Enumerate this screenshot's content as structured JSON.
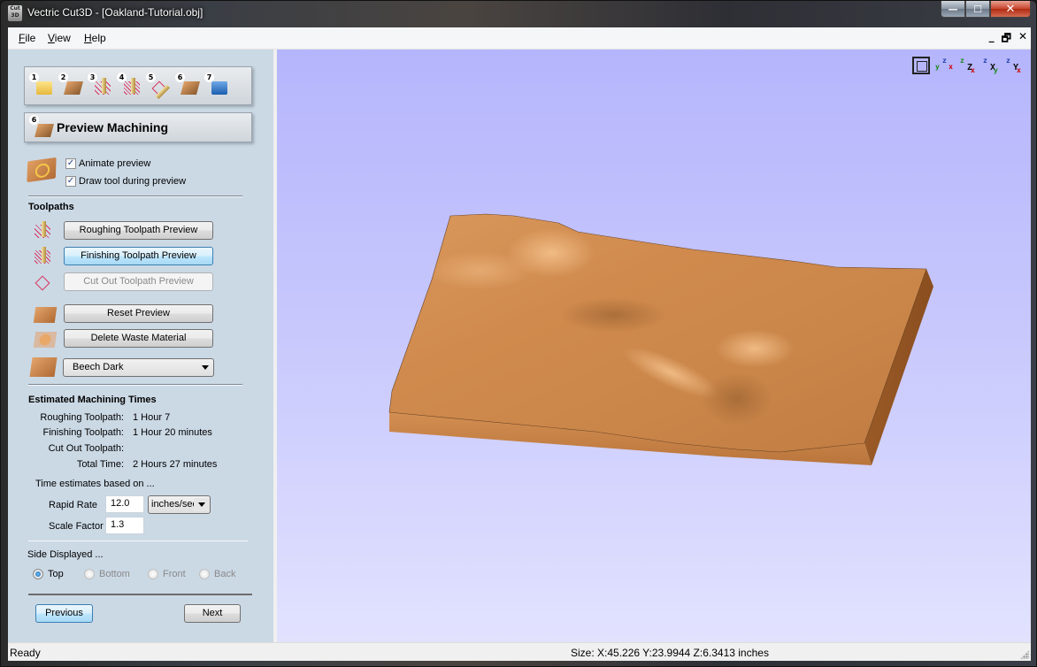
{
  "window": {
    "title": "Vectric Cut3D - [Oakland-Tutorial.obj]",
    "app_icon_label": "Cut 3D",
    "minimize": "—",
    "maximize": "☐",
    "close": "✕"
  },
  "menubar": {
    "items": [
      {
        "label": "File",
        "accel": "F",
        "rest": "ile"
      },
      {
        "label": "View",
        "accel": "V",
        "rest": "iew"
      },
      {
        "label": "Help",
        "accel": "H",
        "rest": "elp"
      }
    ],
    "mdi_minimize": "_",
    "mdi_restore": "🗗",
    "mdi_close": "✕"
  },
  "wizard": {
    "steps": [
      {
        "num": "1",
        "icon": "open-folder-icon"
      },
      {
        "num": "2",
        "icon": "material-block-icon"
      },
      {
        "num": "3",
        "icon": "roughing-toolpath-icon"
      },
      {
        "num": "4",
        "icon": "finishing-toolpath-icon"
      },
      {
        "num": "5",
        "icon": "cutout-toolpath-icon"
      },
      {
        "num": "6",
        "icon": "preview-machining-icon"
      },
      {
        "num": "7",
        "icon": "save-toolpaths-icon"
      }
    ],
    "current_step_num": "6",
    "current_step_title": "Preview Machining"
  },
  "preview_options": {
    "animate_label": "Animate preview",
    "animate_checked": true,
    "draw_tool_label": "Draw tool during preview",
    "draw_tool_checked": true,
    "check_mark": "✓"
  },
  "toolpaths": {
    "title": "Toolpaths",
    "roughing_button": "Roughing Toolpath Preview",
    "finishing_button": "Finishing Toolpath Preview",
    "cutout_button": "Cut Out Toolpath Preview",
    "reset_button": "Reset Preview",
    "delete_waste_button": "Delete Waste Material",
    "material_selected": "Beech Dark"
  },
  "times": {
    "title": "Estimated Machining Times",
    "rows": [
      {
        "label": "Roughing Toolpath:",
        "value": "1 Hour 7"
      },
      {
        "label": "Finishing Toolpath:",
        "value": "1 Hour 20 minutes"
      },
      {
        "label": "Cut Out Toolpath:",
        "value": ""
      },
      {
        "label": "Total Time:",
        "value": "2 Hours 27 minutes"
      }
    ],
    "based_on": "Time estimates based on ...",
    "rapid_rate_label": "Rapid Rate",
    "rapid_rate_value": "12.0",
    "rapid_rate_unit": "inches/sec",
    "scale_factor_label": "Scale Factor",
    "scale_factor_value": "1.3"
  },
  "side_displayed": {
    "title": "Side Displayed ...",
    "options": [
      {
        "label": "Top",
        "selected": true,
        "enabled": true
      },
      {
        "label": "Bottom",
        "selected": false,
        "enabled": false
      },
      {
        "label": "Front",
        "selected": false,
        "enabled": false
      },
      {
        "label": "Back",
        "selected": false,
        "enabled": false
      }
    ]
  },
  "nav": {
    "previous": "Previous",
    "next": "Next"
  },
  "view_toolbar": [
    {
      "name": "zoom-extents-icon"
    },
    {
      "name": "iso-view-icon",
      "labels": [
        "y",
        "z",
        "x"
      ]
    },
    {
      "name": "view-along-z-icon",
      "labels": [
        "z",
        "Z",
        "x"
      ]
    },
    {
      "name": "view-along-x-icon",
      "labels": [
        "z",
        "X",
        "y"
      ]
    },
    {
      "name": "view-along-y-icon",
      "labels": [
        "z",
        "Y",
        "x"
      ]
    }
  ],
  "viewport": {
    "background_top": "#b5b5fd",
    "background_bottom": "#e2e2ff",
    "material_color": "#c98a4f"
  },
  "status": {
    "left": "Ready",
    "size": "Size: X:45.226 Y:23.9944 Z:6.3413 inches"
  }
}
